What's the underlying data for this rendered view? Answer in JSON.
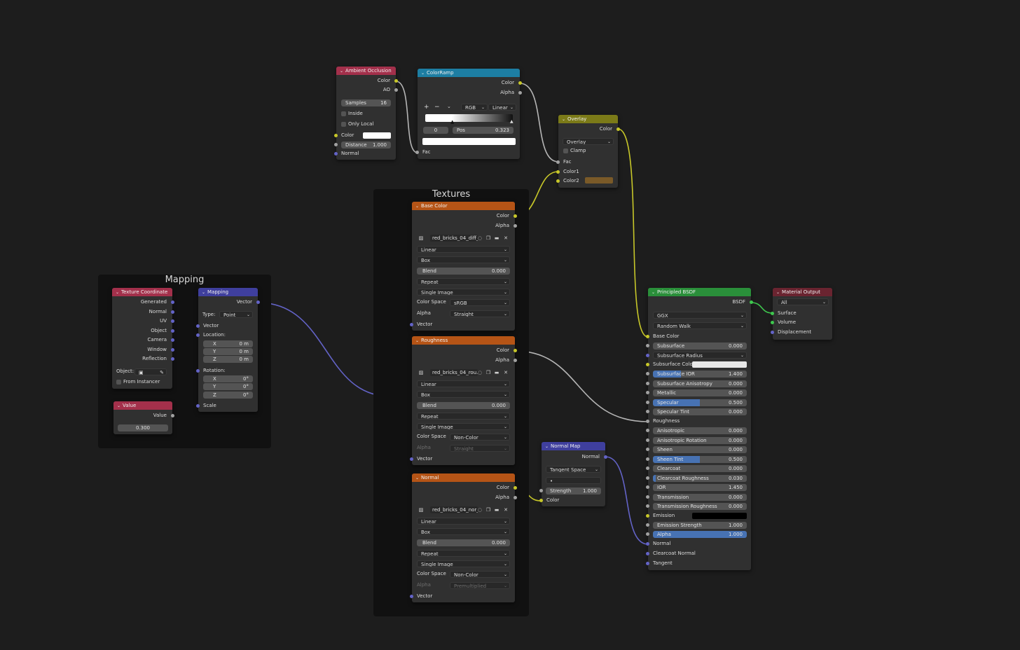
{
  "frames": {
    "textures": "Textures",
    "mapping": "Mapping"
  },
  "ambient_occlusion": {
    "title": "Ambient Occlusion",
    "outputs": [
      "Color",
      "AO"
    ],
    "samples_label": "Samples",
    "samples_value": "16",
    "inside_label": "Inside",
    "only_local_label": "Only Local",
    "color_label": "Color",
    "distance_label": "Distance",
    "distance_value": "1.000",
    "normal_label": "Normal"
  },
  "colorramp": {
    "title": "ColorRamp",
    "outputs": [
      "Color",
      "Alpha"
    ],
    "add": "+",
    "remove": "−",
    "menu": "⌄",
    "mode": "RGB",
    "interp": "Linear",
    "index": "0",
    "pos_label": "Pos",
    "pos_value": "0.323",
    "fac_label": "Fac"
  },
  "overlay": {
    "title": "Overlay",
    "output": "Color",
    "blend_type": "Overlay",
    "clamp_label": "Clamp",
    "inputs": [
      "Fac",
      "Color1",
      "Color2"
    ],
    "color2": "#7a5a28"
  },
  "texture_base": {
    "title": "Base Color",
    "outputs": [
      "Color",
      "Alpha"
    ],
    "image": "red_bricks_04_diff_...",
    "interpolation": "Linear",
    "projection": "Box",
    "blend_label": "Blend",
    "blend_value": "0.000",
    "extension": "Repeat",
    "source": "Single Image",
    "colorspace_label": "Color Space",
    "colorspace": "sRGB",
    "alpha_label": "Alpha",
    "alpha": "Straight",
    "vector_label": "Vector"
  },
  "texture_rough": {
    "title": "Roughness",
    "outputs": [
      "Color",
      "Alpha"
    ],
    "image": "red_bricks_04_rou...",
    "interpolation": "Linear",
    "projection": "Box",
    "blend_label": "Blend",
    "blend_value": "0.000",
    "extension": "Repeat",
    "source": "Single Image",
    "colorspace_label": "Color Space",
    "colorspace": "Non-Color",
    "alpha_label": "Alpha",
    "alpha": "Straight",
    "vector_label": "Vector"
  },
  "texture_normal": {
    "title": "Normal",
    "outputs": [
      "Color",
      "Alpha"
    ],
    "image": "red_bricks_04_nor_...",
    "interpolation": "Linear",
    "projection": "Box",
    "blend_label": "Blend",
    "blend_value": "0.000",
    "extension": "Repeat",
    "source": "Single Image",
    "colorspace_label": "Color Space",
    "colorspace": "Non-Color",
    "alpha_label": "Alpha",
    "alpha": "Premultiplied",
    "vector_label": "Vector"
  },
  "texcoord": {
    "title": "Texture Coordinate",
    "outputs": [
      "Generated",
      "Normal",
      "UV",
      "Object",
      "Camera",
      "Window",
      "Reflection"
    ],
    "object_label": "Object:",
    "from_instancer": "From Instancer"
  },
  "mapping": {
    "title": "Mapping",
    "output": "Vector",
    "type_label": "Type:",
    "type": "Point",
    "vector_label": "Vector",
    "location_label": "Location:",
    "loc": [
      {
        "axis": "X",
        "v": "0 m"
      },
      {
        "axis": "Y",
        "v": "0 m"
      },
      {
        "axis": "Z",
        "v": "0 m"
      }
    ],
    "rotation_label": "Rotation:",
    "rot": [
      {
        "axis": "X",
        "v": "0°"
      },
      {
        "axis": "Y",
        "v": "0°"
      },
      {
        "axis": "Z",
        "v": "0°"
      }
    ],
    "scale_label": "Scale"
  },
  "value_node": {
    "title": "Value",
    "output": "Value",
    "value": "0.300"
  },
  "normal_map": {
    "title": "Normal Map",
    "output": "Normal",
    "space": "Tangent Space",
    "uv": "•",
    "strength_label": "Strength",
    "strength_value": "1.000",
    "color_label": "Color"
  },
  "bsdf": {
    "title": "Principled BSDF",
    "output": "BSDF",
    "distribution": "GGX",
    "subsurface_method": "Random Walk",
    "base_color": "Base Color",
    "subsurface_label": "Subsurface",
    "subsurface_value": "0.000",
    "subsurface_radius": "Subsurface Radius",
    "subsurface_color": "Subsurface Colo",
    "fields": [
      {
        "label": "Subsurface IOR",
        "value": "1.400",
        "fill": 0.3
      },
      {
        "label": "Subsurface Anisotropy",
        "value": "0.000",
        "fill": 0
      },
      {
        "label": "Metallic",
        "value": "0.000",
        "fill": 0
      },
      {
        "label": "Specular",
        "value": "0.500",
        "fill": 0.5
      },
      {
        "label": "Specular Tint",
        "value": "0.000",
        "fill": 0
      }
    ],
    "roughness": "Roughness",
    "fields2": [
      {
        "label": "Anisotropic",
        "value": "0.000",
        "fill": 0
      },
      {
        "label": "Anisotropic Rotation",
        "value": "0.000",
        "fill": 0
      },
      {
        "label": "Sheen",
        "value": "0.000",
        "fill": 0
      },
      {
        "label": "Sheen Tint",
        "value": "0.500",
        "fill": 0.5
      },
      {
        "label": "Clearcoat",
        "value": "0.000",
        "fill": 0
      },
      {
        "label": "Clearcoat Roughness",
        "value": "0.030",
        "fill": 0.03
      },
      {
        "label": "IOR",
        "value": "1.450",
        "fill": 0
      },
      {
        "label": "Transmission",
        "value": "0.000",
        "fill": 0
      },
      {
        "label": "Transmission Roughness",
        "value": "0.000",
        "fill": 0
      }
    ],
    "emission": "Emission",
    "emission_strength_label": "Emission Strength",
    "emission_strength_value": "1.000",
    "alpha_label": "Alpha",
    "alpha_value": "1.000",
    "alpha_fill": 1,
    "normal": "Normal",
    "clearcoat_normal": "Clearcoat Normal",
    "tangent": "Tangent"
  },
  "material_output": {
    "title": "Material Output",
    "target": "All",
    "inputs": [
      "Surface",
      "Volume",
      "Displacement"
    ]
  },
  "colors": {
    "input_header": "#a3304b",
    "texture_header": "#b55416",
    "converter_header": "#1d7ea3",
    "color_header": "#7b7a18",
    "vector_header": "#3f3f9e",
    "shader_header": "#2a8f3a",
    "output_header": "#6a2430",
    "accent_blue": "#4772b3"
  }
}
